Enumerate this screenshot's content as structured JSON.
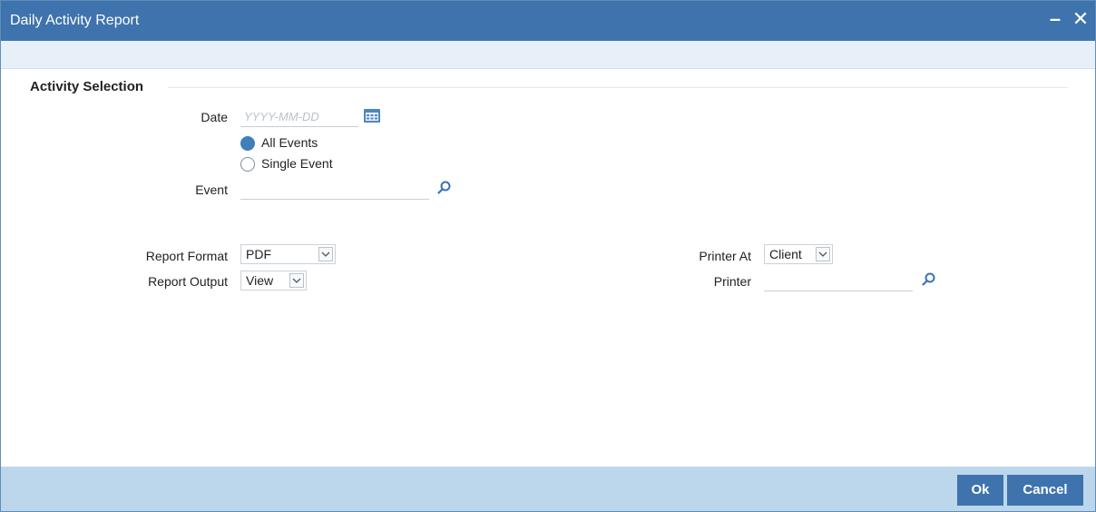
{
  "window": {
    "title": "Daily Activity Report",
    "minimize_glyph": "–",
    "close_glyph": "✕"
  },
  "section": {
    "title": "Activity Selection"
  },
  "date": {
    "label": "Date",
    "placeholder": "YYYY-MM-DD",
    "value": "",
    "icon": "calendar-icon"
  },
  "radio": {
    "all_events": "All Events",
    "single_event": "Single Event",
    "selected": "all_events"
  },
  "event": {
    "label": "Event",
    "value": "",
    "icon": "search-icon"
  },
  "report_format": {
    "label": "Report Format",
    "value": "PDF"
  },
  "report_output": {
    "label": "Report Output",
    "value": "View"
  },
  "printer_at": {
    "label": "Printer At",
    "value": "Client"
  },
  "printer": {
    "label": "Printer",
    "value": "",
    "icon": "search-icon"
  },
  "buttons": {
    "ok": "Ok",
    "cancel": "Cancel"
  },
  "colors": {
    "titlebar": "#3e73ad",
    "footer": "#bcd6ec",
    "button": "#3e73ad",
    "radio_selected": "#3f7fba"
  }
}
